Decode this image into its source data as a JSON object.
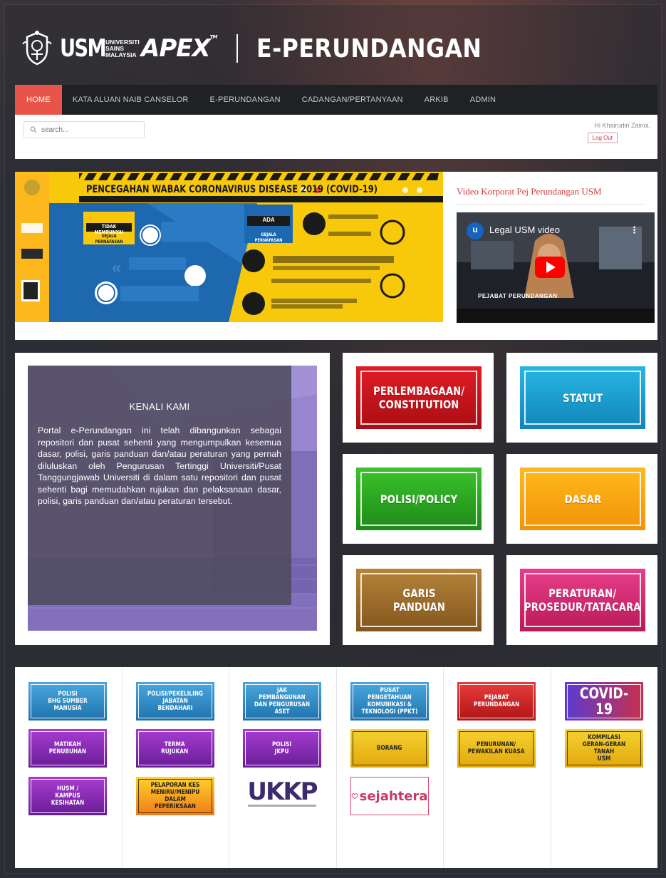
{
  "header": {
    "usm_mark": "USM",
    "usm_subtitle": "UNIVERSITI SAINS MALAYSIA",
    "apex_logo": "APEX",
    "apex_tm": "TM",
    "site_title": "E-PERUNDANGAN"
  },
  "nav": {
    "items": [
      {
        "label": "HOME"
      },
      {
        "label": "KATA ALUAN NAIB CANSELOR"
      },
      {
        "label": "E-PERUNDANGAN"
      },
      {
        "label": "CADANGAN/PERTANYAAN"
      },
      {
        "label": "ARKIB"
      },
      {
        "label": "ADMIN"
      }
    ]
  },
  "search": {
    "placeholder": "search..."
  },
  "user": {
    "greeting": "Hi Khairudin Zainol,",
    "logout_label": "Log Out"
  },
  "banner": {
    "headline": "PENCEGAHAN WABAK CORONAVIRUS DISEASE 2019 (COVID-19)",
    "badge_left_top": "TIDAK MEMPUNYAI",
    "badge_left_bottom": "GEJALA PERNAFASAN",
    "badge_right_top": "ADA",
    "badge_right_bottom": "GEJALA PERNAFASAN"
  },
  "video": {
    "section_title": "Video Korporat Pej Perundangan USM",
    "channel_initial": "u",
    "title": "Legal USM video",
    "caption": "PEJABAT PERUNDANGAN"
  },
  "about": {
    "title": "KENALI KAMI",
    "text": "Portal e-Perundangan ini telah dibangunkan sebagai repositori dan pusat sehenti yang mengumpulkan kesemua dasar, polisi, garis panduan dan/atau peraturan yang pernah diluluskan oleh Pengurusan Tertinggi Universiti/Pusat Tanggungjawab Universiti di dalam satu repositori dan pusat sehenti bagi memudahkan rujukan dan pelaksanaan dasar, polisi, garis panduan dan/atau peraturan tersebut."
  },
  "tiles": [
    {
      "label": "PERLEMBAGAAN/\nCONSTITUTION",
      "color": "#c8141e"
    },
    {
      "label": "STATUT",
      "color": "#1a9fd0"
    },
    {
      "label": "POLISI/POLICY",
      "color": "#2aa021"
    },
    {
      "label": "DASAR",
      "color": "#f5a511"
    },
    {
      "label": "GARIS\nPANDUAN",
      "color": "#9a6b2b"
    },
    {
      "label": "PERATURAN/\nPROSEDUR/TATACARA",
      "color": "#d12c72"
    }
  ],
  "links": {
    "col1": [
      "POLISI\nBHG SUMBER MANUSIA",
      "MATIKAH\nPENUBUHAN",
      "HUSM /\nKAMPUS KESIHATAN"
    ],
    "col2": [
      "POLISI/PEKELILING\nJABATAN BENDAHARI",
      "TERMA\nRUJUKAN",
      "PELAPORAN KES\nMENIRU/MENIPU\nDALAM PEPERIKSAAN"
    ],
    "col3": [
      "JAK PEMBANGUNAN\nDAN PENGURUSAN ASET",
      "POLISI\nJKPU",
      "UKKP"
    ],
    "col4": [
      "PUSAT PENGETAHUAN\nKOMUNIKASI &\nTEKNOLOGI (PPKT)",
      "BORANG",
      "sejahtera"
    ],
    "col5": [
      "PEJABAT\nPERUNDANGAN",
      "PENURUNAN/\nPEWAKILAN KUASA"
    ],
    "col6": [
      "COVID-19",
      "KOMPILASI\nGERAN-GERAN TANAH\nUSM"
    ]
  }
}
